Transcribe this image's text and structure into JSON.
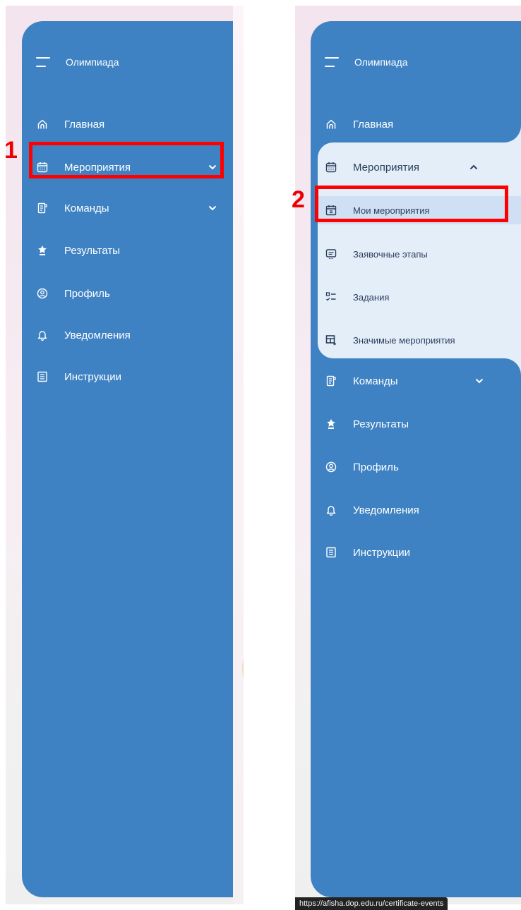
{
  "app_title": "Олимпиада",
  "markers": {
    "one": "1",
    "two": "2"
  },
  "menu": {
    "home": "Главная",
    "events": "Мероприятия",
    "teams": "Команды",
    "results": "Результаты",
    "profile": "Профиль",
    "notifications": "Уведомления",
    "instructions": "Инструкции"
  },
  "submenu": {
    "my_events": "Мои мероприятия",
    "application_stages": "Заявочные этапы",
    "tasks": "Задания",
    "significant_events": "Значимые мероприятия"
  },
  "status_url": "https://afisha.dop.edu.ru/certificate-events",
  "colors": {
    "sidebar": "#3e82c3",
    "submenu_bg": "#e3eef9",
    "highlight": "#ff0000"
  }
}
